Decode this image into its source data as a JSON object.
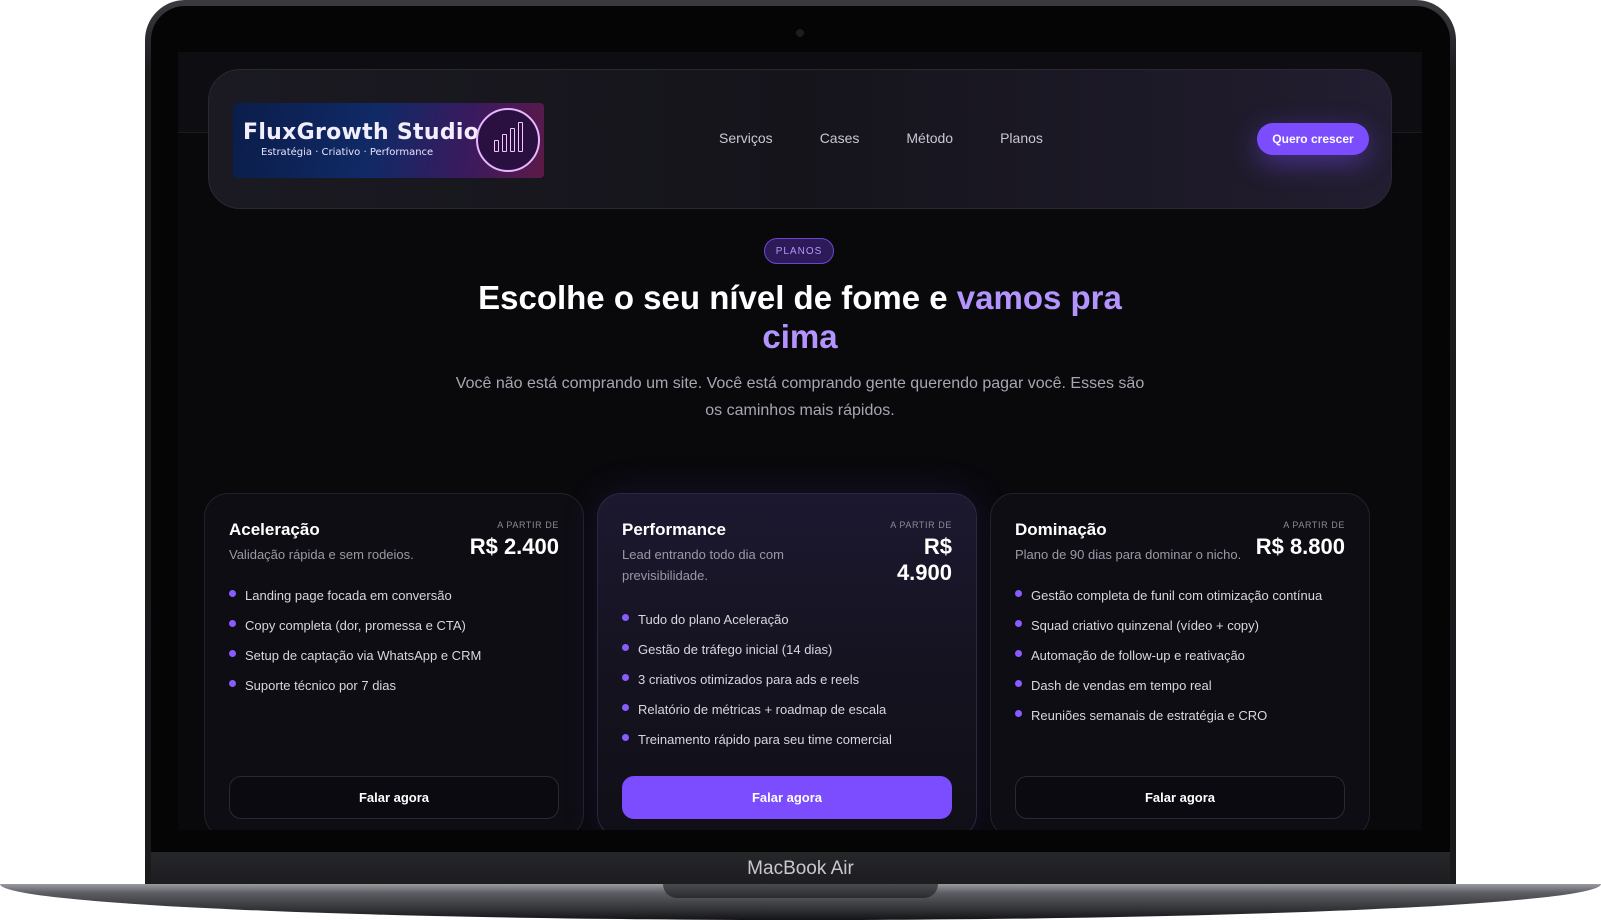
{
  "device": {
    "label": "MacBook Air"
  },
  "header": {
    "logo_title": "FluxGrowth Studio",
    "logo_subtitle": "Estratégia · Criativo · Performance",
    "nav": [
      "Serviços",
      "Cases",
      "Método",
      "Planos"
    ],
    "cta": "Quero crescer"
  },
  "hero": {
    "badge": "PLANOS",
    "title_main": "Escolhe o seu nível de fome e ",
    "title_accent": "vamos pra cima",
    "subtitle": "Você não está comprando um site. Você está comprando gente querendo pagar você. Esses são os caminhos mais rápidos."
  },
  "plans": [
    {
      "name": "Aceleração",
      "description": "Validação rápida e sem rodeios.",
      "price_label": "A PARTIR DE",
      "price": "R$ 2.400",
      "features": [
        "Landing page focada em conversão",
        "Copy completa (dor, promessa e CTA)",
        "Setup de captação via WhatsApp e CRM",
        "Suporte técnico por 7 dias"
      ],
      "button": "Falar agora"
    },
    {
      "name": "Performance",
      "description": "Lead entrando todo dia com previsibilidade.",
      "price_label": "A PARTIR DE",
      "price": "R$ 4.900",
      "features": [
        "Tudo do plano Aceleração",
        "Gestão de tráfego inicial (14 dias)",
        "3 criativos otimizados para ads e reels",
        "Relatório de métricas + roadmap de escala",
        "Treinamento rápido para seu time comercial"
      ],
      "button": "Falar agora"
    },
    {
      "name": "Dominação",
      "description": "Plano de 90 dias para dominar o nicho.",
      "price_label": "A PARTIR DE",
      "price": "R$ 8.800",
      "features": [
        "Gestão completa de funil com otimização contínua",
        "Squad criativo quinzenal (vídeo + copy)",
        "Automação de follow-up e reativação",
        "Dash de vendas em tempo real",
        "Reuniões semanais de estratégia e CRO"
      ],
      "button": "Falar agora"
    }
  ],
  "colors": {
    "accent": "#7c4dff",
    "accent_text": "#b394ff",
    "background": "#09090c"
  }
}
